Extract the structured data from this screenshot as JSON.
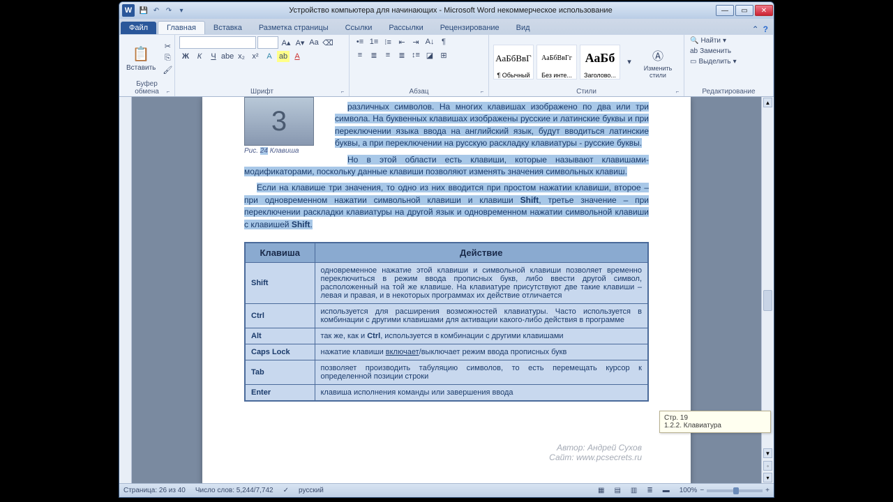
{
  "titlebar": {
    "icon_letter": "W",
    "title": "Устройство компьютера для начинающих - Microsoft Word некоммерческое использование"
  },
  "tabs": {
    "file": "Файл",
    "items": [
      "Главная",
      "Вставка",
      "Разметка страницы",
      "Ссылки",
      "Рассылки",
      "Рецензирование",
      "Вид"
    ],
    "active_index": 0
  },
  "ribbon": {
    "clipboard": {
      "paste": "Вставить",
      "label": "Буфер обмена"
    },
    "font": {
      "label": "Шрифт",
      "bold": "Ж",
      "italic": "К",
      "underline": "Ч"
    },
    "paragraph": {
      "label": "Абзац"
    },
    "styles": {
      "label": "Стили",
      "change": "Изменить стили",
      "sample": "АаБбВвГ",
      "sample2": "АаБбВвГг",
      "sample3": "АаБб",
      "names": [
        "¶ Обычный",
        "Без инте...",
        "Заголово..."
      ]
    },
    "editing": {
      "label": "Редактирование",
      "find": "Найти",
      "replace": "Заменить",
      "select": "Выделить"
    }
  },
  "document": {
    "fig_key": "3",
    "fig_caption_prefix": "Рис. ",
    "fig_num": "24",
    "fig_caption_suffix": " Клавиша",
    "p1": "различных символов. На многих клавишах изображено по два или три символа. На буквенных клавишах изображены русские и латинские буквы и при переключении языка ввода на английский язык, будут вводиться латинские буквы, а при переключении на русскую раскладку клавиатуры - русские буквы.",
    "p2": "Но в этой области есть клавиши, которые называют клавишами-модификаторами, поскольку данные клавиши позволяют изменять значения символьных клавиш.",
    "p3a": "Если на клавише три значения, то одно из них вводится при простом нажатии клавиши, второе – при одновременном нажатии символьной клавиши и клавиши ",
    "p3b": "Shift",
    "p3c": ", третье значение – при переключении раскладки клавиатуры на другой язык и одновременном нажатии символьной клавиши с клавишей ",
    "p3d": "Shift",
    "table": {
      "headers": [
        "Клавиша",
        "Действие"
      ],
      "rows": [
        {
          "key": "Shift",
          "desc": "одновременное нажатие этой клавиши и символьной клавиши позволяет временно переключиться в режим ввода прописных букв, либо ввести другой символ, расположенный на той же клавише. На клавиатуре присутствуют две такие клавиши – левая и правая, и в некоторых программах их действие отличается"
        },
        {
          "key": "Ctrl",
          "desc": "используется для расширения возможностей клавиатуры. Часто используется в комбинации с другими клавишами для активации какого-либо действия в программе"
        },
        {
          "key": "Alt",
          "desc_prefix": "так же, как и ",
          "desc_bold": "Ctrl",
          "desc_suffix": ", используется в комбинации с другими клавишами"
        },
        {
          "key": "Caps Lock",
          "desc_prefix": "нажатие клавиши ",
          "desc_link": "включает",
          "desc_suffix": "/выключает режим ввода прописных букв"
        },
        {
          "key": "Tab",
          "desc": "позволяет производить табуляцию символов, то есть перемещать курсор к определенной позиции строки"
        },
        {
          "key": "Enter",
          "desc": "клавиша исполнения команды или завершения ввода"
        }
      ]
    }
  },
  "tooltip": {
    "line1": "Стр. 19",
    "line2": "1.2.2. Клавиатура"
  },
  "status": {
    "page": "Страница: 26 из 40",
    "words": "Число слов: 5,244/7,742",
    "lang": "русский",
    "zoom": "100%"
  },
  "watermark": {
    "line1": "Автор: Андрей Сухов",
    "line2": "Сайт: www.pcsecrets.ru"
  }
}
